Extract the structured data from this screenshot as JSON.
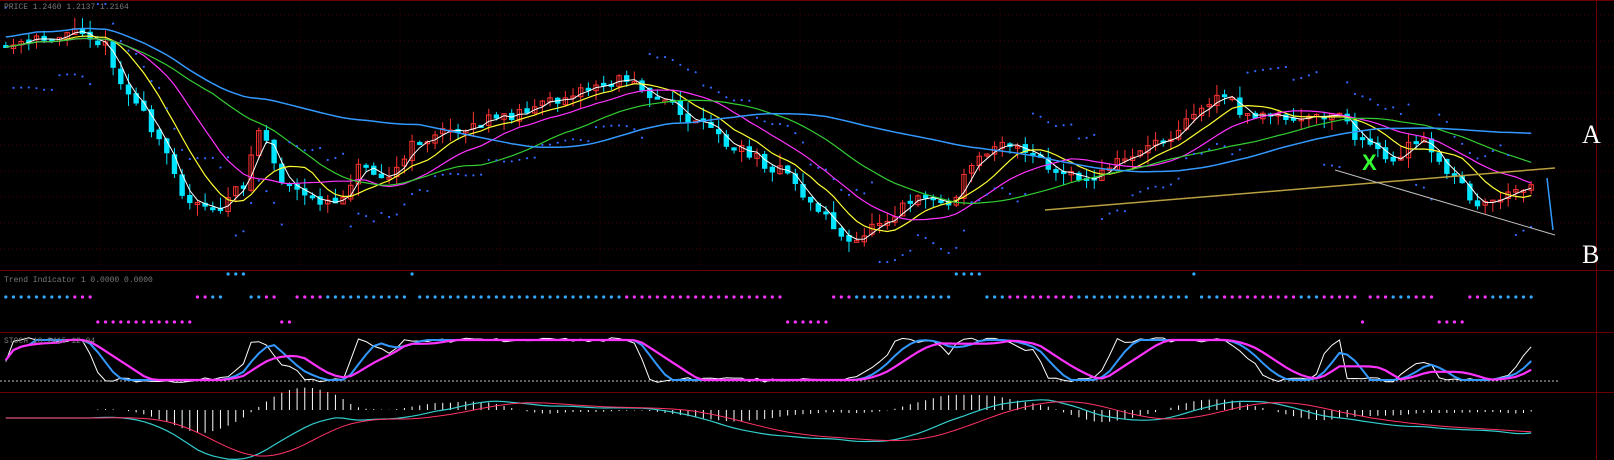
{
  "chart_data": {
    "type": "candlestick",
    "panels": [
      {
        "name": "price",
        "header": "PRICE 1.2460 1.2137 1.2164"
      },
      {
        "name": "trend_indicator",
        "header": "Trend Indicator 1 0.0000 0.0000"
      },
      {
        "name": "stochastic",
        "header": "STOCH 10.2415 12.04"
      },
      {
        "name": "macd",
        "header": ""
      }
    ],
    "annotations": [
      {
        "id": "A",
        "text": "A"
      },
      {
        "id": "B",
        "text": "B"
      },
      {
        "id": "X",
        "text": "X"
      }
    ],
    "colors": {
      "bull_candle": "#ff3333",
      "bear_candle": "#00e5ff",
      "ma_fast": "#ffffff",
      "ma_2": "#ffff33",
      "ma_3": "#ff33ff",
      "ma_4": "#33cc33",
      "ma_5": "#3399ff",
      "psar": "#3366ff",
      "trend_up": "#ff33ff",
      "trend_down": "#33aaff",
      "trendline_support": "#b8a040",
      "trendline_down": "#c0c0c0",
      "stoch_k": "#ffffff",
      "stoch_d": "#3399ff",
      "stoch_slow": "#ff33ff",
      "grid": "#6a0000"
    },
    "grid": true,
    "candle_count": 200
  }
}
